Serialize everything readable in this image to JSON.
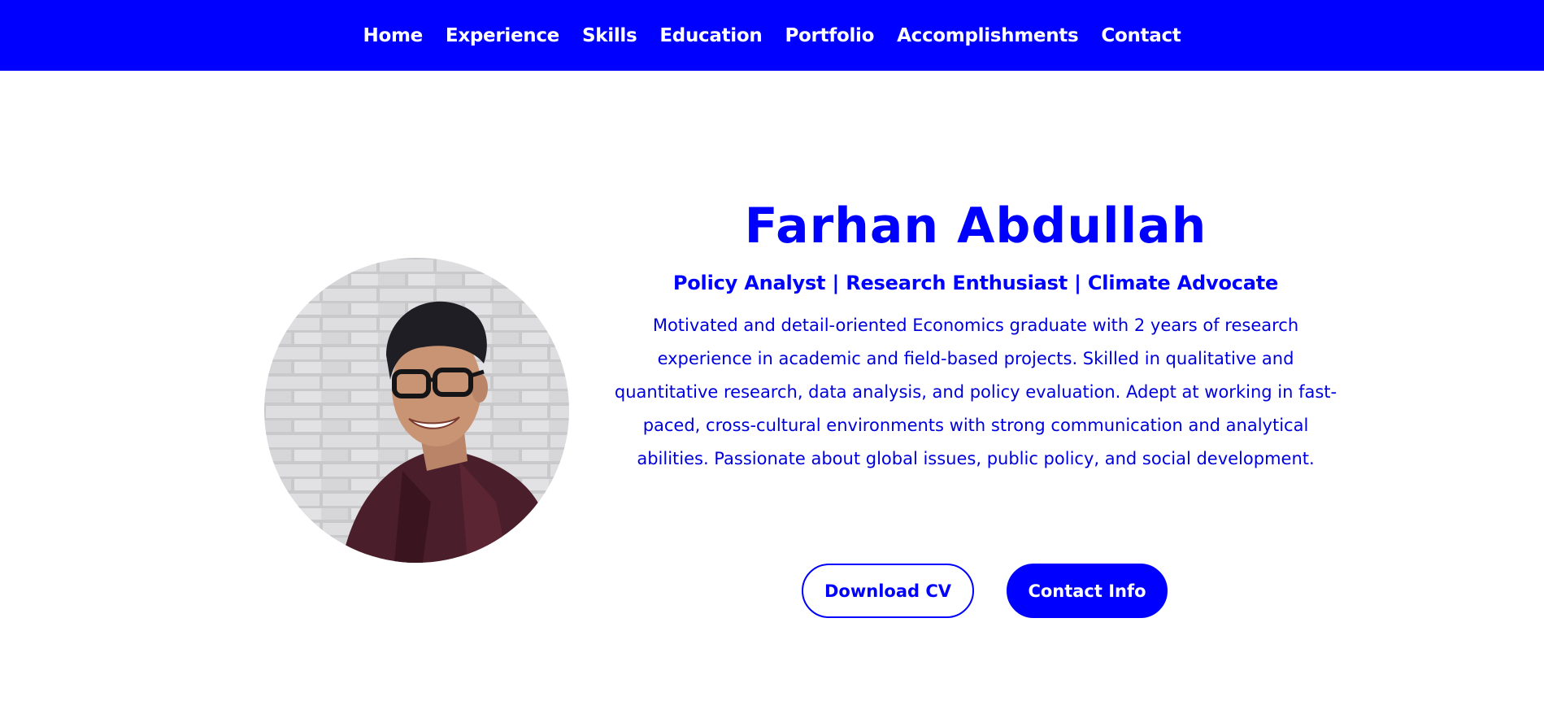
{
  "nav": {
    "items": [
      {
        "label": "Home"
      },
      {
        "label": "Experience"
      },
      {
        "label": "Skills"
      },
      {
        "label": "Education"
      },
      {
        "label": "Portfolio"
      },
      {
        "label": "Accomplishments"
      },
      {
        "label": "Contact"
      }
    ]
  },
  "hero": {
    "name": "Farhan Abdullah",
    "tagline": "Policy Analyst | Research Enthusiast | Climate Advocate",
    "bio": "Motivated and detail-oriented Economics graduate with 2 years of research experience in academic and field-based projects. Skilled in qualitative and quantitative research, data analysis, and policy evaluation. Adept at working in fast-paced, cross-cultural environments with strong communication and analytical abilities. Passionate about global issues, public policy, and social development.",
    "download_cv_label": "Download CV",
    "contact_info_label": "Contact Info"
  },
  "colors": {
    "brand": "#0000ff",
    "background": "#ffffff"
  }
}
